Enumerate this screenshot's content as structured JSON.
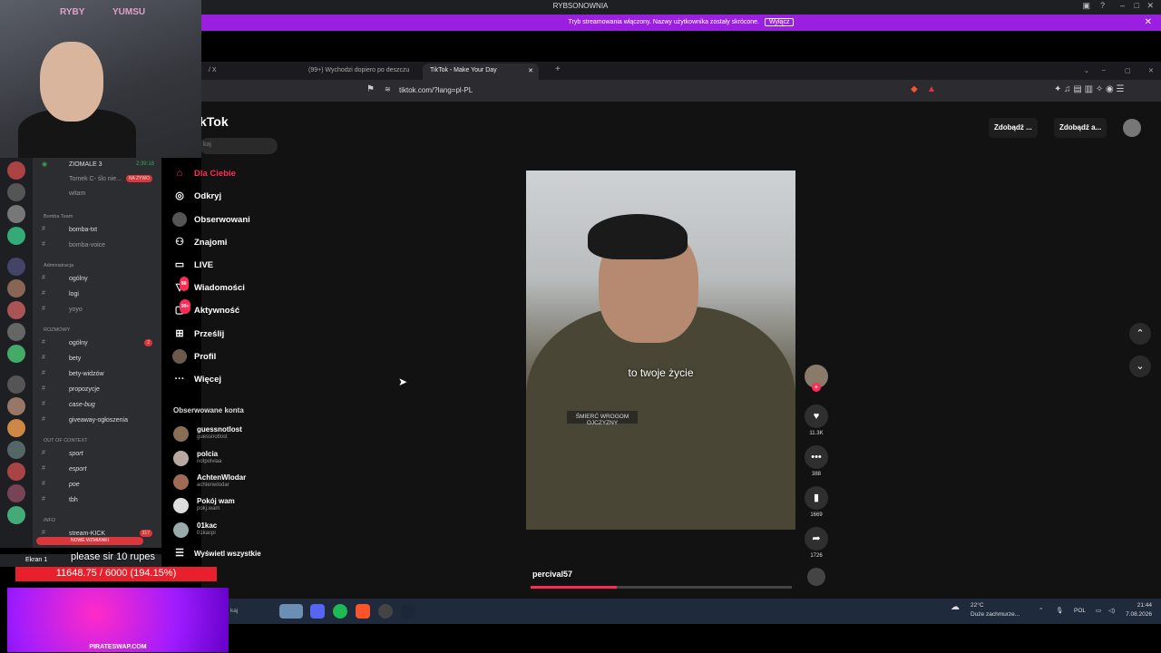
{
  "discord_titlebar": {
    "title": "RYBSONOWNIA"
  },
  "stream_banner": {
    "message": "Tryb streamowania włączony. Nazwy użytkownika zostały skrócone.",
    "button": "Wyłącz",
    "close": "✕"
  },
  "browser": {
    "tabs": [
      {
        "label": "/ X"
      },
      {
        "label": "(99+) Wychodzi dopiero po deszczu"
      },
      {
        "label": "TikTok - Make Your Day",
        "active": true
      }
    ],
    "new_tab": "+",
    "url": "tiktok.com/?lang=pl-PL"
  },
  "tiktok": {
    "logo": "kTok",
    "search_placeholder": "kaj",
    "nav": [
      {
        "label": "Dla Ciebie",
        "icon": "home-icon",
        "active": true
      },
      {
        "label": "Odkryj",
        "icon": "compass-icon"
      },
      {
        "label": "Obserwowani",
        "icon": "following-icon"
      },
      {
        "label": "Znajomi",
        "icon": "friends-icon"
      },
      {
        "label": "LIVE",
        "icon": "live-icon"
      },
      {
        "label": "Wiadomości",
        "icon": "messages-icon",
        "badge": "88"
      },
      {
        "label": "Aktywność",
        "icon": "activity-icon",
        "badge": "99+"
      },
      {
        "label": "Prześlij",
        "icon": "upload-icon"
      },
      {
        "label": "Profil",
        "icon": "profile-icon"
      },
      {
        "label": "Więcej",
        "icon": "more-icon"
      }
    ],
    "following_header": "Obserwowane konta",
    "accounts": [
      {
        "name": "guessnotlost",
        "handle": "guessnotlost"
      },
      {
        "name": "polcia",
        "handle": "notpolviaa"
      },
      {
        "name": "AchtenWlodar",
        "handle": "achtenwlodar"
      },
      {
        "name": "Pokój wam",
        "handle": "pokj.wam"
      },
      {
        "name": "01kac",
        "handle": "01kacpi"
      }
    ],
    "show_all": "Wyświetl wszystkie",
    "top_buttons": [
      "Zdobądź ...",
      "Zdobądź a..."
    ],
    "video": {
      "caption": "to twoje życie",
      "patch": "ŚMIERĆ WROGOM OJCZYZNY",
      "username": "percival57",
      "progress": 0.33,
      "likes": "11.3K",
      "comments": "388",
      "saves": "1669",
      "shares": "1726"
    }
  },
  "discord": {
    "webcam_sign_left": "RYBY",
    "webcam_sign_right": "YUMSU",
    "channels": [
      {
        "type": "voice",
        "label": "ZIOMALE 3",
        "extra": "2:39:18"
      },
      {
        "type": "user",
        "label": "Tomek C- ślo nie...",
        "pill": "NA ŻYWO"
      },
      {
        "type": "user",
        "label": "witam"
      },
      {
        "type": "cat",
        "label": "Bomba Team"
      },
      {
        "type": "text",
        "label": "bomba-txt"
      },
      {
        "type": "text",
        "label": "bomba-voice"
      },
      {
        "type": "cat",
        "label": "Administracja"
      },
      {
        "type": "text",
        "label": "ogólny"
      },
      {
        "type": "text",
        "label": "logi"
      },
      {
        "type": "text",
        "label": "yoyo"
      },
      {
        "type": "cat",
        "label": "ROZMOWY"
      },
      {
        "type": "text",
        "label": "ogólny",
        "pill": "2"
      },
      {
        "type": "text",
        "label": "bety"
      },
      {
        "type": "text",
        "label": "bety-widzów"
      },
      {
        "type": "text",
        "label": "propozycje"
      },
      {
        "type": "text",
        "label": "case-bug"
      },
      {
        "type": "text",
        "label": "giveaway-ogłoszenia"
      },
      {
        "type": "cat",
        "label": "OUT OF CONTEXT"
      },
      {
        "type": "text",
        "label": "sport"
      },
      {
        "type": "text",
        "label": "esport"
      },
      {
        "type": "text",
        "label": "poe"
      },
      {
        "type": "text",
        "label": "tbh"
      },
      {
        "type": "cat",
        "label": "INFO"
      },
      {
        "type": "text",
        "label": "stream-KICK",
        "pill": "317"
      }
    ],
    "new_mentions": "NOWE WZMIANKI",
    "screen_share": "Ekran 1"
  },
  "overlay": {
    "donation": "please sir 10 rupes",
    "goal": "11648.75 / 6000 (194.15%)",
    "promo": "PIRATESWAP.COM"
  },
  "taskbar": {
    "search": "kaj",
    "weather_temp": "22°C",
    "weather_desc": "Duże zachmurze...",
    "lang": "POL",
    "time": "21:44",
    "date": "7.08.2026"
  }
}
